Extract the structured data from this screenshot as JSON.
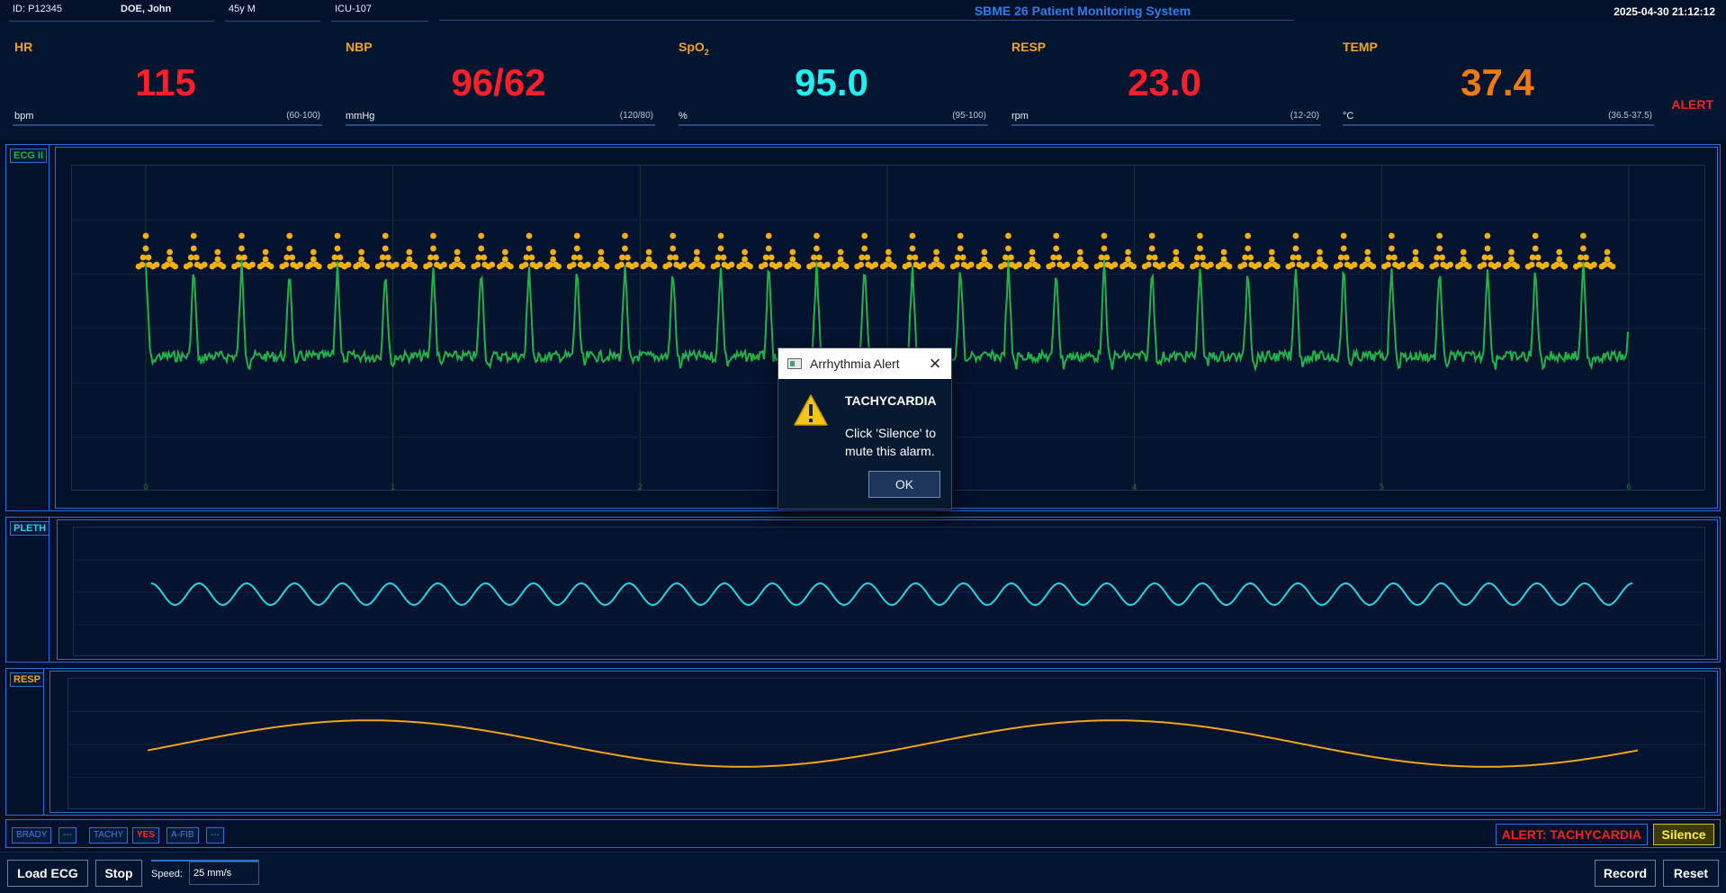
{
  "patient": {
    "id": "ID: P12345",
    "name": "DOE, John",
    "age_sex": "45y M",
    "location": "ICU-107"
  },
  "system_title": "SBME 26 Patient Monitoring System",
  "datetime": "2025-04-30  21:12:12",
  "vitals": [
    {
      "label": "HR",
      "value": "115",
      "unit": "bpm",
      "range": "(60-100)",
      "color": "#ff1f2b"
    },
    {
      "label": "NBP",
      "value": "96/62",
      "unit": "mmHg",
      "range": "(120/80)",
      "color": "#ff1f2b"
    },
    {
      "label": "SpO",
      "label_sub": "2",
      "value": "95.0",
      "unit": "%",
      "range": "(95-100)",
      "color": "#22f0f0"
    },
    {
      "label": "RESP",
      "value": "23.0",
      "unit": "rpm",
      "range": "(12-20)",
      "color": "#ff1f2b"
    },
    {
      "label": "TEMP",
      "value": "37.4",
      "unit": "°C",
      "range": "(36.5-37.5)",
      "color": "#f07a12"
    }
  ],
  "alert_word": "ALERT",
  "panels": {
    "ecg": {
      "tag": "ECG II",
      "color": "#22b24a",
      "marker_color": "#f0b012",
      "x_ticks": [
        "0",
        "1",
        "2",
        "3",
        "4",
        "5",
        "6"
      ],
      "beats": 31
    },
    "pleth": {
      "tag": "PLETH",
      "color": "#22d4e6",
      "cycles": 31
    },
    "resp": {
      "tag": "RESP",
      "color": "#f0a51a",
      "cycles": 2
    }
  },
  "status": {
    "chips": [
      {
        "label": "BRADY",
        "value": "---"
      },
      {
        "label": "TACHY",
        "value": "YES"
      },
      {
        "label": "A-FIB",
        "value": "---"
      }
    ],
    "alert": "ALERT: TACHYCARDIA",
    "silence": "Silence"
  },
  "controls": {
    "load": "Load ECG",
    "stop": "Stop",
    "speed_label": "Speed:",
    "speed_value": "25 mm/s",
    "record": "Record",
    "reset": "Reset"
  },
  "dialog": {
    "title": "Arrhythmia Alert",
    "heading": "TACHYCARDIA",
    "message": "Click 'Silence' to mute this alarm.",
    "ok": "OK"
  }
}
